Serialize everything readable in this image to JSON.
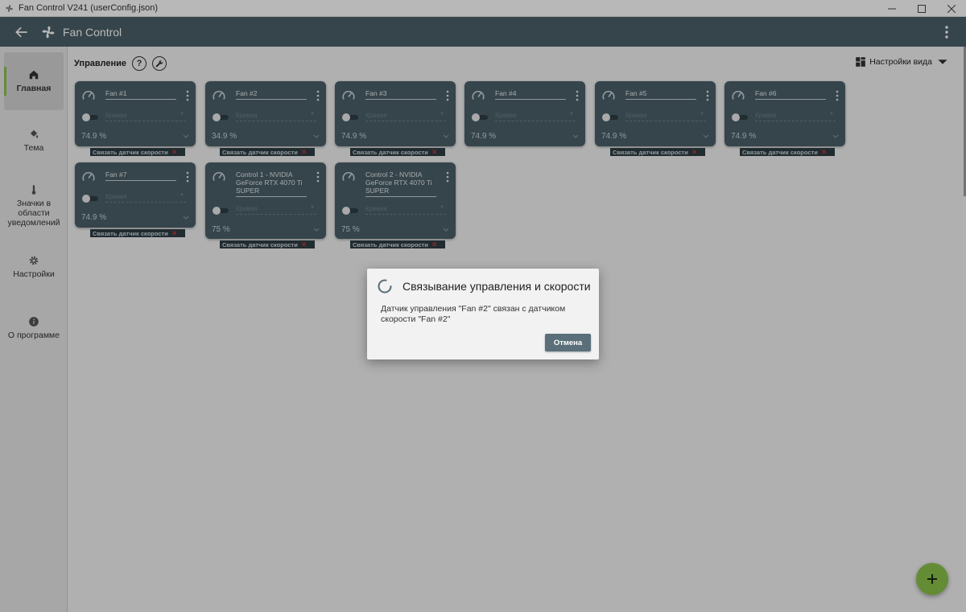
{
  "window": {
    "title": "Fan Control V241 (userConfig.json)"
  },
  "appbar": {
    "title": "Fan Control"
  },
  "sidebar": {
    "items": [
      {
        "label": "Главная",
        "icon": "home-icon",
        "active": true
      },
      {
        "label": "Тема",
        "icon": "paint-bucket-icon",
        "active": false
      },
      {
        "label": "Значки в области уведомлений",
        "icon": "thermometer-icon",
        "active": false
      },
      {
        "label": "Настройки",
        "icon": "gear-icon",
        "active": false
      },
      {
        "label": "О программе",
        "icon": "info-icon",
        "active": false
      }
    ]
  },
  "main": {
    "section_title": "Управление",
    "help_symbol": "?",
    "view_settings_label": "Настройки вида"
  },
  "cards": [
    {
      "name": "Fan #1",
      "curve": "Кривая",
      "value": "74.9 %",
      "link_label": "Связать датчик скорости"
    },
    {
      "name": "Fan #2",
      "curve": "Кривая",
      "value": "34.9 %",
      "link_label": "Связать датчик скорости"
    },
    {
      "name": "Fan #3",
      "curve": "Кривая",
      "value": "74.9 %",
      "link_label": "Связать датчик скорости"
    },
    {
      "name": "Fan #4",
      "curve": "Кривая",
      "value": "74.9 %",
      "link_label": "Связать датчик скорости"
    },
    {
      "name": "Fan #5",
      "curve": "Кривая",
      "value": "74.9 %",
      "link_label": "Связать датчик скорости"
    },
    {
      "name": "Fan #6",
      "curve": "Кривая",
      "value": "74.9 %",
      "link_label": "Связать датчик скорости"
    },
    {
      "name": "Fan #7",
      "curve": "Кривая",
      "value": "74.9 %",
      "link_label": "Связать датчик скорости"
    },
    {
      "name": "Control 1 - NVIDIA GeForce RTX 4070 Ti SUPER",
      "curve": "Кривая",
      "value": "75 %",
      "link_label": "Связать датчик скорости"
    },
    {
      "name": "Control 2 - NVIDIA GeForce RTX 4070 Ti SUPER",
      "curve": "Кривая",
      "value": "75 %",
      "link_label": "Связать датчик скорости"
    }
  ],
  "dialog": {
    "title": "Связывание управления и скорости",
    "message": "Датчик управления \"Fan #2\" связан с датчиком скорости \"Fan #2\"",
    "cancel_label": "Отмена"
  },
  "colors": {
    "appbar": "#4b606a",
    "card": "#4b606a",
    "accent": "#8bc34a",
    "unlink_x": "#e53935"
  }
}
